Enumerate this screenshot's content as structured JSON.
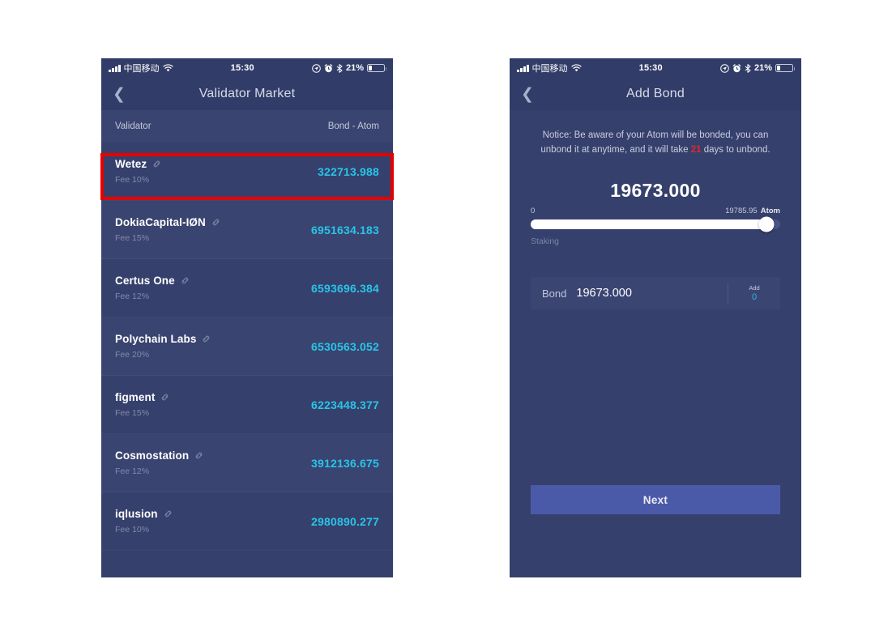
{
  "status_bar": {
    "carrier": "中国移动",
    "time": "15:30",
    "battery_percent": "21%",
    "signal_icon": "signal-bars-icon",
    "wifi_icon": "wifi-icon",
    "location_icon": "location-arrow-icon",
    "alarm_icon": "alarm-clock-icon",
    "bluetooth_icon": "bluetooth-icon",
    "battery_icon": "battery-icon"
  },
  "left_screen": {
    "nav": {
      "back_icon": "chevron-left-icon",
      "title": "Validator Market"
    },
    "list_header": {
      "col_validator": "Validator",
      "col_bond": "Bond - Atom"
    },
    "link_icon": "link-icon",
    "validators": [
      {
        "name": "Wetez",
        "fee": "Fee 10%",
        "amount": "322713.988"
      },
      {
        "name": "DokiaCapital-IØN",
        "fee": "Fee 15%",
        "amount": "6951634.183"
      },
      {
        "name": "Certus One",
        "fee": "Fee 12%",
        "amount": "6593696.384"
      },
      {
        "name": "Polychain Labs",
        "fee": "Fee 20%",
        "amount": "6530563.052"
      },
      {
        "name": "figment",
        "fee": "Fee 15%",
        "amount": "6223448.377"
      },
      {
        "name": "Cosmostation",
        "fee": "Fee 12%",
        "amount": "3912136.675"
      },
      {
        "name": "iqlusion",
        "fee": "Fee 10%",
        "amount": "2980890.277"
      }
    ],
    "highlight": {
      "target": "Wetez",
      "color": "#e60000"
    }
  },
  "right_screen": {
    "nav": {
      "back_icon": "chevron-left-icon",
      "title": "Add Bond"
    },
    "notice": {
      "part1": "Notice: Be aware of your Atom will be bonded, you can unbond it at anytime, and it will take ",
      "days": "21",
      "part2": " days to unbond."
    },
    "amount_display": "19673.000",
    "slider": {
      "min_label": "0",
      "max_label": "19785.95",
      "unit": "Atom",
      "sub_label": "Staking",
      "value_percent": "94.5"
    },
    "bond_field": {
      "label": "Bond",
      "value": "19673.000",
      "add_title": "Add",
      "add_value": "0"
    },
    "next_button": "Next"
  },
  "colors": {
    "screen_bg": "#36406c",
    "bar_bg": "#323c68",
    "accent_cyan": "#28c5e8",
    "button_blue": "#4b5aa8",
    "alert_red": "#e3262d",
    "highlight_red": "#e60000"
  }
}
